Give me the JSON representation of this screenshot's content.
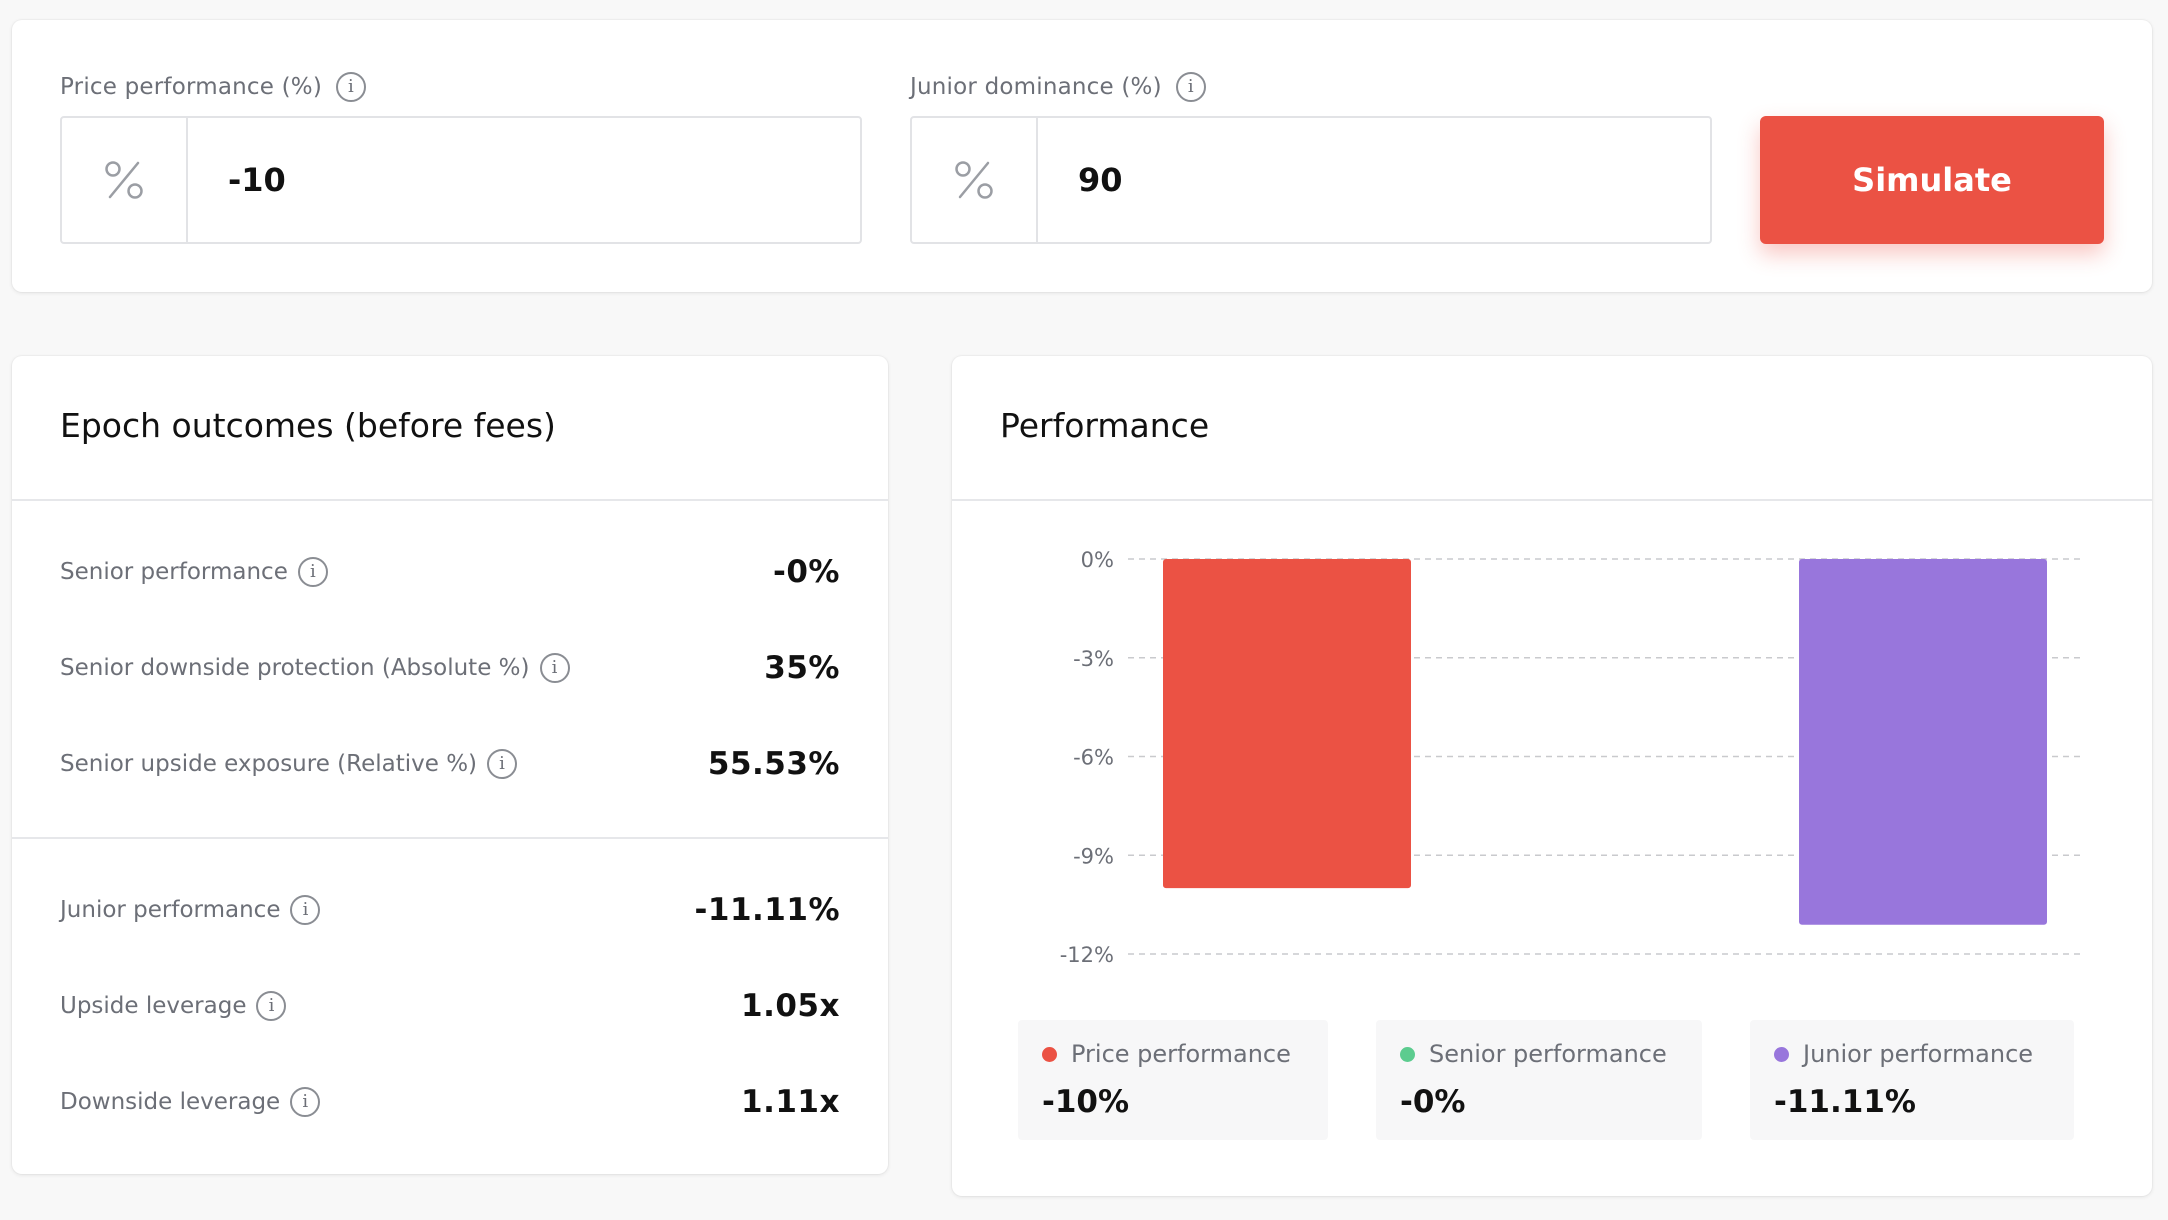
{
  "form": {
    "price_label": "Price performance (%)",
    "price_value": "-10",
    "junior_label": "Junior dominance (%)",
    "junior_value": "90",
    "simulate_label": "Simulate",
    "prefix_symbol": "%",
    "info_glyph": "i"
  },
  "outcomes": {
    "title": "Epoch outcomes (before fees)",
    "senior": [
      {
        "label": "Senior performance",
        "value": "-0%"
      },
      {
        "label": "Senior downside protection (Absolute %)",
        "value": "35%"
      },
      {
        "label": "Senior upside exposure (Relative %)",
        "value": "55.53%"
      }
    ],
    "junior": [
      {
        "label": "Junior performance",
        "value": "-11.11%"
      },
      {
        "label": "Upside leverage",
        "value": "1.05x"
      },
      {
        "label": "Downside leverage",
        "value": "1.11x"
      }
    ]
  },
  "performance": {
    "title": "Performance",
    "legend": [
      {
        "name": "Price performance",
        "value": "-10%",
        "color": "#eb5244"
      },
      {
        "name": "Senior performance",
        "value": "-0%",
        "color": "#5ccc8f"
      },
      {
        "name": "Junior performance",
        "value": "-11.11%",
        "color": "#9876dc"
      }
    ]
  },
  "chart_data": {
    "type": "bar",
    "categories": [
      "Price performance",
      "Senior performance",
      "Junior performance"
    ],
    "values": [
      -10,
      0,
      -11.11
    ],
    "colors": [
      "#eb5244",
      "#5ccc8f",
      "#9876dc"
    ],
    "ylim": [
      -12,
      0
    ],
    "yticks": [
      0,
      -3,
      -6,
      -9,
      -12
    ],
    "ytick_labels": [
      "0%",
      "-3%",
      "-6%",
      "-9%",
      "-12%"
    ],
    "grid": true,
    "title": "",
    "xlabel": "",
    "ylabel": ""
  }
}
